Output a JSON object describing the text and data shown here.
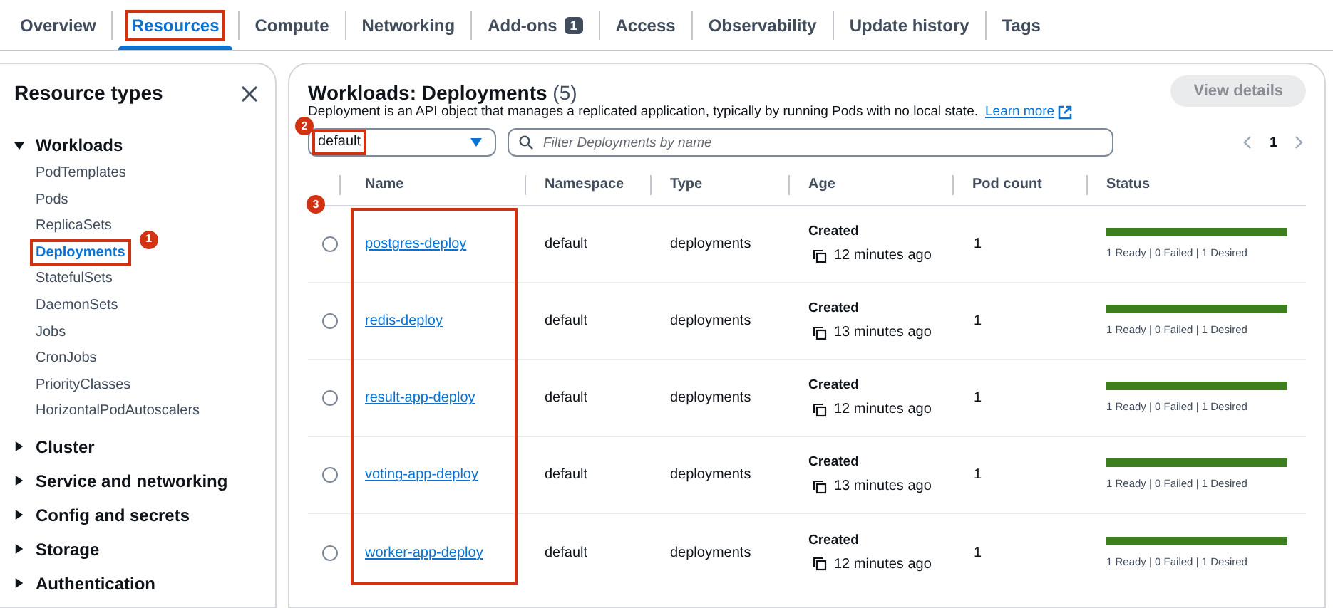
{
  "tabs": [
    {
      "label": "Overview",
      "selected": false,
      "highlighted": false
    },
    {
      "label": "Resources",
      "selected": true,
      "highlighted": true
    },
    {
      "label": "Compute",
      "selected": false,
      "highlighted": false
    },
    {
      "label": "Networking",
      "selected": false,
      "highlighted": false
    },
    {
      "label": "Add-ons",
      "badge": "1",
      "selected": false,
      "highlighted": false
    },
    {
      "label": "Access",
      "selected": false,
      "highlighted": false
    },
    {
      "label": "Observability",
      "selected": false,
      "highlighted": false
    },
    {
      "label": "Update history",
      "selected": false,
      "highlighted": false
    },
    {
      "label": "Tags",
      "selected": false,
      "highlighted": false
    }
  ],
  "sidebar": {
    "title": "Resource types",
    "groups": [
      {
        "label": "Workloads",
        "expanded": true,
        "children": [
          {
            "label": "PodTemplates",
            "selected": false,
            "highlighted": false
          },
          {
            "label": "Pods",
            "selected": false,
            "highlighted": false
          },
          {
            "label": "ReplicaSets",
            "selected": false,
            "highlighted": false
          },
          {
            "label": "Deployments",
            "selected": true,
            "highlighted": true,
            "annotation": "1"
          },
          {
            "label": "StatefulSets",
            "selected": false,
            "highlighted": false
          },
          {
            "label": "DaemonSets",
            "selected": false,
            "highlighted": false
          },
          {
            "label": "Jobs",
            "selected": false,
            "highlighted": false
          },
          {
            "label": "CronJobs",
            "selected": false,
            "highlighted": false
          },
          {
            "label": "PriorityClasses",
            "selected": false,
            "highlighted": false
          },
          {
            "label": "HorizontalPodAutoscalers",
            "selected": false,
            "highlighted": false
          }
        ]
      },
      {
        "label": "Cluster",
        "expanded": false
      },
      {
        "label": "Service and networking",
        "expanded": false
      },
      {
        "label": "Config and secrets",
        "expanded": false
      },
      {
        "label": "Storage",
        "expanded": false
      },
      {
        "label": "Authentication",
        "expanded": false
      }
    ]
  },
  "main": {
    "title": "Workloads: Deployments",
    "count": "(5)",
    "description": "Deployment is an API object that manages a replicated application, typically by running Pods with no local state.",
    "learn_more": "Learn more",
    "view_details": {
      "label": "View details",
      "disabled": true
    },
    "namespace_select": {
      "value": "default",
      "highlighted": true,
      "annotation": "2"
    },
    "filter": {
      "placeholder": "Filter Deployments by name"
    },
    "pagination": {
      "page": "1"
    },
    "name_column_annotation": "3",
    "table": {
      "columns": [
        "Name",
        "Namespace",
        "Type",
        "Age",
        "Pod count",
        "Status"
      ],
      "rows": [
        {
          "selected": false,
          "name": "postgres-deploy",
          "namespace": "default",
          "type": "deployments",
          "age_label": "Created",
          "age": "12 minutes ago",
          "pod_count": "1",
          "level": 1,
          "status": "1 Ready | 0 Failed | 1 Desired"
        },
        {
          "selected": false,
          "name": "redis-deploy",
          "namespace": "default",
          "type": "deployments",
          "age_label": "Created",
          "age": "13 minutes ago",
          "pod_count": "1",
          "level": 1,
          "status": "1 Ready | 0 Failed | 1 Desired"
        },
        {
          "selected": false,
          "name": "result-app-deploy",
          "namespace": "default",
          "type": "deployments",
          "age_label": "Created",
          "age": "12 minutes ago",
          "pod_count": "1",
          "level": 1,
          "status": "1 Ready | 0 Failed | 1 Desired"
        },
        {
          "selected": false,
          "name": "voting-app-deploy",
          "namespace": "default",
          "type": "deployments",
          "age_label": "Created",
          "age": "13 minutes ago",
          "pod_count": "1",
          "level": 1,
          "status": "1 Ready | 0 Failed | 1 Desired"
        },
        {
          "selected": false,
          "name": "worker-app-deploy",
          "namespace": "default",
          "type": "deployments",
          "age_label": "Created",
          "age": "12 minutes ago",
          "pod_count": "1",
          "level": 1,
          "status": "1 Ready | 0 Failed | 1 Desired"
        }
      ]
    }
  }
}
